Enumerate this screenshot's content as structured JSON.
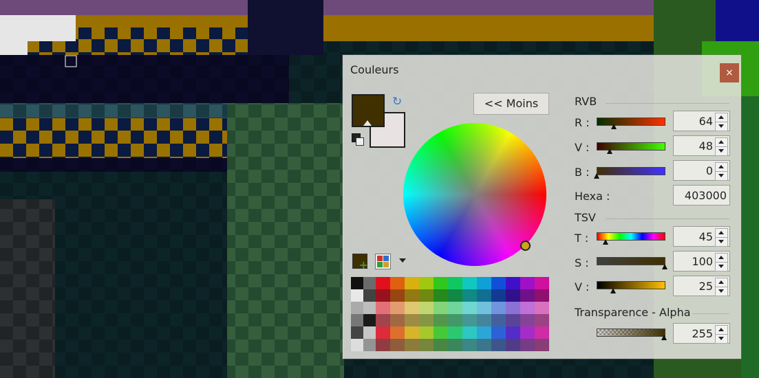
{
  "dialog": {
    "title": "Couleurs",
    "close_label": "×",
    "toggle_label": "<< Moins"
  },
  "colors": {
    "primary": "#403000",
    "secondary": "#e8e2e2",
    "accent_close": "#b05a40"
  },
  "rgb": {
    "section": "RVB",
    "r": {
      "label": "R :",
      "value": "64"
    },
    "g": {
      "label": "V :",
      "value": "48"
    },
    "b": {
      "label": "B :",
      "value": "0"
    },
    "hex": {
      "label": "Hexa :",
      "value": "403000"
    }
  },
  "hsv": {
    "section": "TSV",
    "h": {
      "label": "T :",
      "value": "45"
    },
    "s": {
      "label": "S :",
      "value": "100"
    },
    "v": {
      "label": "V :",
      "value": "25"
    }
  },
  "alpha": {
    "section": "Transparence - Alpha",
    "value": "255"
  },
  "icons": {
    "swap": "↻",
    "add": "+"
  },
  "palette": {
    "hues": [
      "#e01020",
      "#e06010",
      "#d8b010",
      "#a0c810",
      "#30c820",
      "#10c860",
      "#10c8c0",
      "#10a0d8",
      "#1050d8",
      "#4010c8",
      "#a010c8",
      "#d010a0"
    ]
  }
}
